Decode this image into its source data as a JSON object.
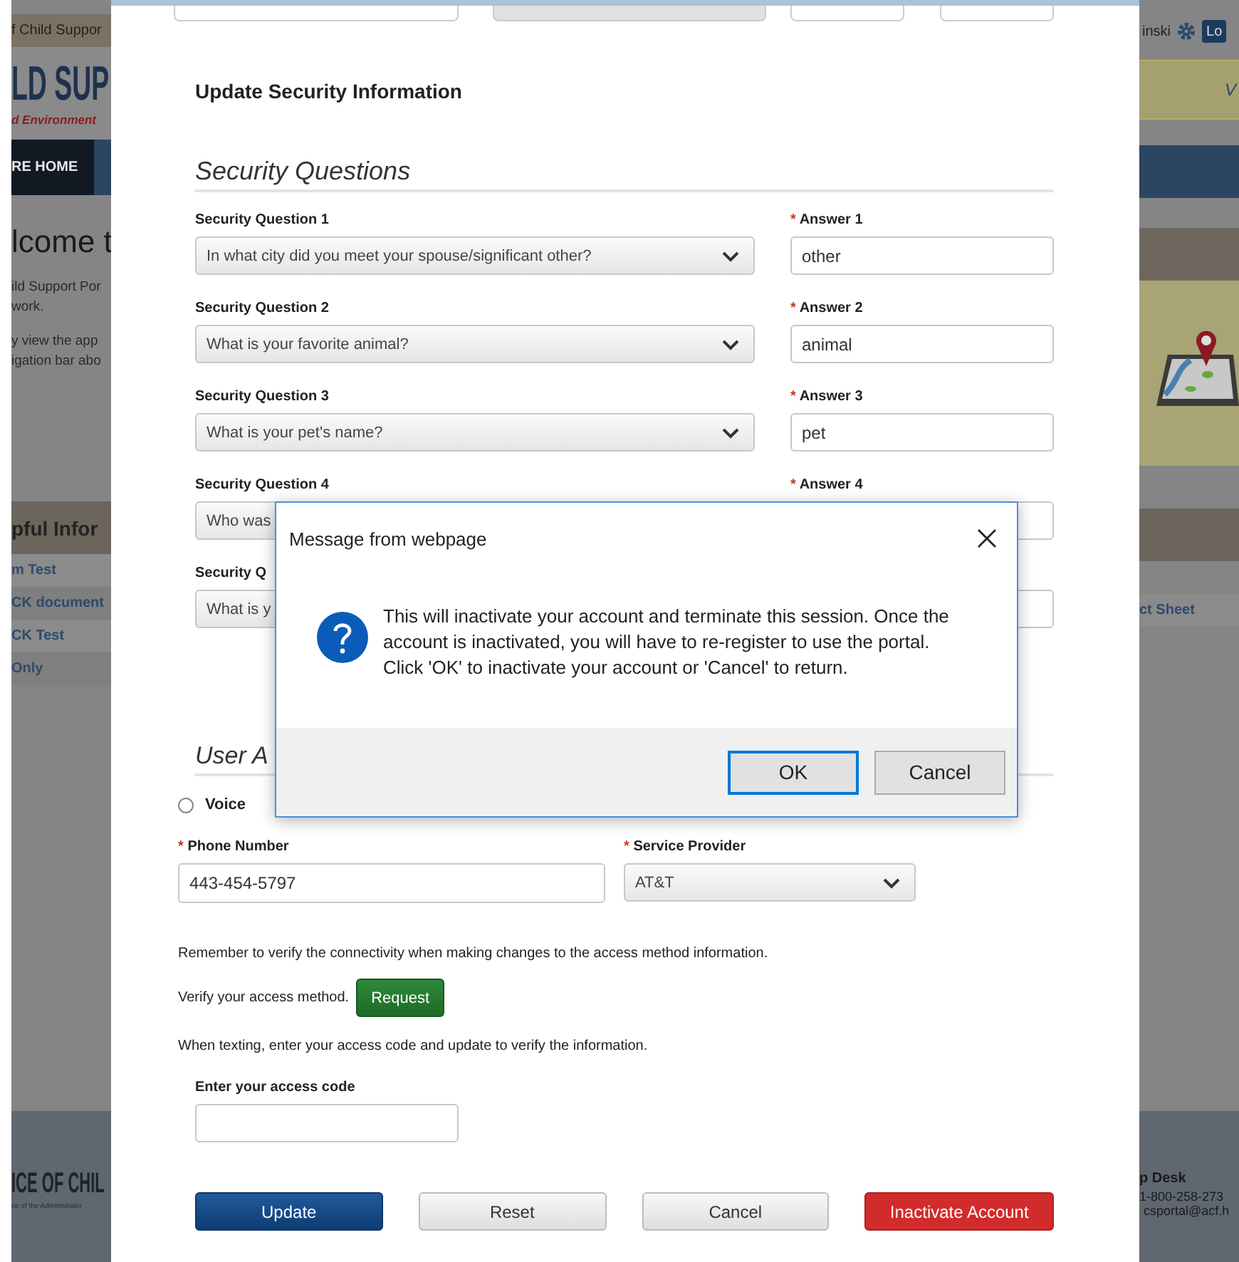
{
  "background_page": {
    "left": {
      "agency_strip": "f Child Suppor",
      "logo_title": "LD SUP",
      "logo_subtitle": "d Environment",
      "nav_item": "RE HOME",
      "welcome_heading": "lcome t",
      "welcome_lines": [
        "ild Support Por",
        "work.",
        "y view the app",
        "igation bar abo"
      ],
      "section_heading": "pful Infor",
      "links": [
        "m Test",
        "CK document",
        "CK Test",
        "Only"
      ],
      "footer_title": "ICE OF CHIL",
      "footer_subtitle": "ce of the Administratio"
    },
    "right": {
      "user_name": "inski",
      "logout_button": "Lo",
      "banner_text": "V",
      "link": "ct Sheet",
      "help_title": "p Desk",
      "help_phone": "1-800-258-273",
      "help_email": "csportal@acf.h"
    }
  },
  "form": {
    "title": "Update Security Information",
    "section_title": "Security Questions",
    "questions": [
      {
        "label": "Security Question 1",
        "value": "In what city did you meet your spouse/significant other?",
        "answer_mark": "*",
        "answer_label": "Answer 1",
        "answer": "other"
      },
      {
        "label": "Security Question 2",
        "value": "What is your favorite animal?",
        "answer_mark": "*",
        "answer_label": "Answer 2",
        "answer": "animal"
      },
      {
        "label": "Security Question 3",
        "value": "What is your pet's name?",
        "answer_mark": "*",
        "answer_label": "Answer 3",
        "answer": "pet"
      },
      {
        "label": "Security Question 4",
        "value": "Who was",
        "answer_mark": "*",
        "answer_label": "Answer 4"
      },
      {
        "label": "Security Q",
        "value": "What is y"
      }
    ],
    "access_section_title": "User A",
    "access_options": [
      {
        "label": "Voice",
        "selected": false
      }
    ],
    "phone": {
      "mark": "*",
      "label": "Phone Number",
      "value": "443-454-5797"
    },
    "provider": {
      "mark": "*",
      "label": "Service Provider",
      "value": "AT&T"
    },
    "reminder": "Remember to verify the connectivity when making changes to the access method information.",
    "verify_text": "Verify your access method.",
    "request_button": "Request",
    "texting_note": "When texting, enter your access code and update to verify the information.",
    "code_label": "Enter your access code",
    "buttons": [
      {
        "label": "Update",
        "kind": "primary"
      },
      {
        "label": "Reset",
        "kind": "default"
      },
      {
        "label": "Cancel",
        "kind": "default"
      },
      {
        "label": "Inactivate Account",
        "kind": "danger"
      }
    ]
  },
  "dialog": {
    "title": "Message from webpage",
    "message": "This will inactivate your account and terminate this session. Once the account is inactivated, you will have to re-register to use the portal. Click 'OK' to inactivate your account or 'Cancel' to return.",
    "buttons": [
      {
        "label": "OK",
        "selected": true
      },
      {
        "label": "Cancel",
        "selected": false
      }
    ]
  }
}
